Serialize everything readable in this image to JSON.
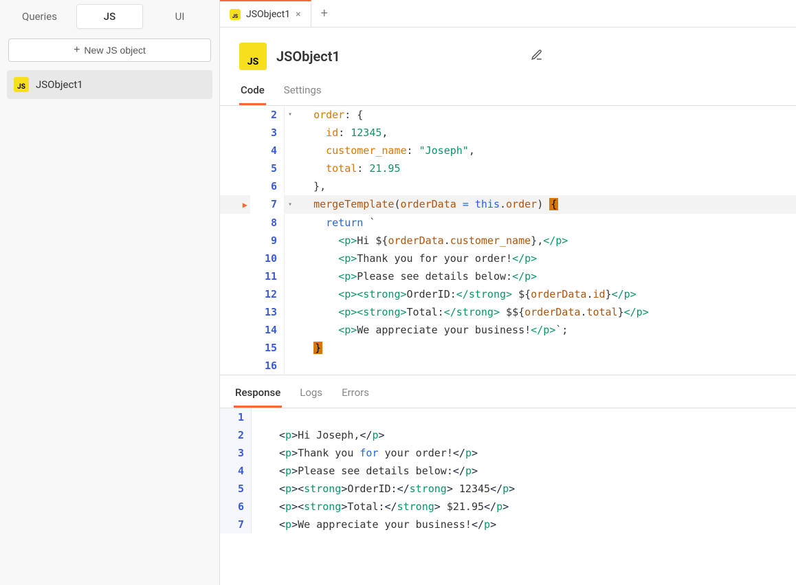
{
  "sidebar": {
    "tabs": [
      "Queries",
      "JS",
      "UI"
    ],
    "active_tab": 1,
    "new_button_label": "New JS object",
    "items": [
      {
        "icon": "js-badge-icon",
        "label": "JSObject1",
        "active": true
      }
    ]
  },
  "tabs_bar": {
    "tabs": [
      {
        "icon": "js-badge-icon",
        "label": "JSObject1",
        "closeable": true
      }
    ]
  },
  "header": {
    "icon": "js-badge-icon",
    "title": "JSObject1"
  },
  "sub_tabs": {
    "items": [
      "Code",
      "Settings"
    ],
    "active": 0
  },
  "code_editor": {
    "lines": [
      {
        "n": 2,
        "fold": "▾",
        "tokens": [
          {
            "t": "  ",
            "c": ""
          },
          {
            "t": "order",
            "c": "tok-orange"
          },
          {
            "t": ": {",
            "c": ""
          }
        ]
      },
      {
        "n": 3,
        "tokens": [
          {
            "t": "    ",
            "c": ""
          },
          {
            "t": "id",
            "c": "tok-orange"
          },
          {
            "t": ": ",
            "c": ""
          },
          {
            "t": "12345",
            "c": "tok-num"
          },
          {
            "t": ",",
            "c": ""
          }
        ]
      },
      {
        "n": 4,
        "tokens": [
          {
            "t": "    ",
            "c": ""
          },
          {
            "t": "customer_name",
            "c": "tok-orange"
          },
          {
            "t": ": ",
            "c": ""
          },
          {
            "t": "\"Joseph\"",
            "c": "tok-str"
          },
          {
            "t": ",",
            "c": ""
          }
        ]
      },
      {
        "n": 5,
        "tokens": [
          {
            "t": "    ",
            "c": ""
          },
          {
            "t": "total",
            "c": "tok-orange"
          },
          {
            "t": ": ",
            "c": ""
          },
          {
            "t": "21.95",
            "c": "tok-num"
          }
        ]
      },
      {
        "n": 6,
        "tokens": [
          {
            "t": "  },",
            "c": ""
          }
        ]
      },
      {
        "n": 7,
        "fold": "▾",
        "bp": true,
        "hl": true,
        "tokens": [
          {
            "t": "  ",
            "c": ""
          },
          {
            "t": "mergeTemplate",
            "c": "tok-fn"
          },
          {
            "t": "(",
            "c": ""
          },
          {
            "t": "orderData",
            "c": "tok-var"
          },
          {
            "t": " ",
            "c": ""
          },
          {
            "t": "=",
            "c": "tok-op"
          },
          {
            "t": " ",
            "c": ""
          },
          {
            "t": "this",
            "c": "tok-this"
          },
          {
            "t": ".",
            "c": ""
          },
          {
            "t": "order",
            "c": "tok-var"
          },
          {
            "t": ") ",
            "c": ""
          },
          {
            "t": "{",
            "c": "tok-brace-err"
          }
        ]
      },
      {
        "n": 8,
        "tokens": [
          {
            "t": "    ",
            "c": ""
          },
          {
            "t": "return",
            "c": "tok-purple"
          },
          {
            "t": " `",
            "c": ""
          }
        ]
      },
      {
        "n": 9,
        "tokens": [
          {
            "t": "      ",
            "c": ""
          },
          {
            "t": "<p>",
            "c": "tok-tag"
          },
          {
            "t": "Hi ",
            "c": "tok-txt"
          },
          {
            "t": "${",
            "c": ""
          },
          {
            "t": "orderData",
            "c": "tok-var"
          },
          {
            "t": ".",
            "c": ""
          },
          {
            "t": "customer_name",
            "c": "tok-var"
          },
          {
            "t": "}",
            "c": ""
          },
          {
            "t": ",",
            "c": "tok-txt"
          },
          {
            "t": "</p>",
            "c": "tok-tag"
          }
        ]
      },
      {
        "n": 10,
        "tokens": [
          {
            "t": "      ",
            "c": ""
          },
          {
            "t": "<p>",
            "c": "tok-tag"
          },
          {
            "t": "Thank you for your order!",
            "c": "tok-txt"
          },
          {
            "t": "</p>",
            "c": "tok-tag"
          }
        ]
      },
      {
        "n": 11,
        "tokens": [
          {
            "t": "      ",
            "c": ""
          },
          {
            "t": "<p>",
            "c": "tok-tag"
          },
          {
            "t": "Please see details below:",
            "c": "tok-txt"
          },
          {
            "t": "</p>",
            "c": "tok-tag"
          }
        ]
      },
      {
        "n": 12,
        "tokens": [
          {
            "t": "      ",
            "c": ""
          },
          {
            "t": "<p><strong>",
            "c": "tok-tag"
          },
          {
            "t": "OrderID:",
            "c": "tok-txt"
          },
          {
            "t": "</strong>",
            "c": "tok-tag"
          },
          {
            "t": " ",
            "c": "tok-txt"
          },
          {
            "t": "${",
            "c": ""
          },
          {
            "t": "orderData",
            "c": "tok-var"
          },
          {
            "t": ".",
            "c": ""
          },
          {
            "t": "id",
            "c": "tok-var"
          },
          {
            "t": "}",
            "c": ""
          },
          {
            "t": "</p>",
            "c": "tok-tag"
          }
        ]
      },
      {
        "n": 13,
        "tokens": [
          {
            "t": "      ",
            "c": ""
          },
          {
            "t": "<p><strong>",
            "c": "tok-tag"
          },
          {
            "t": "Total:",
            "c": "tok-txt"
          },
          {
            "t": "</strong>",
            "c": "tok-tag"
          },
          {
            "t": " $",
            "c": "tok-txt"
          },
          {
            "t": "${",
            "c": ""
          },
          {
            "t": "orderData",
            "c": "tok-var"
          },
          {
            "t": ".",
            "c": ""
          },
          {
            "t": "total",
            "c": "tok-var"
          },
          {
            "t": "}",
            "c": ""
          },
          {
            "t": "</p>",
            "c": "tok-tag"
          }
        ]
      },
      {
        "n": 14,
        "tokens": [
          {
            "t": "      ",
            "c": ""
          },
          {
            "t": "<p>",
            "c": "tok-tag"
          },
          {
            "t": "We appreciate your business!",
            "c": "tok-txt"
          },
          {
            "t": "</p>",
            "c": "tok-tag"
          },
          {
            "t": "`;",
            "c": ""
          }
        ]
      },
      {
        "n": 15,
        "tokens": [
          {
            "t": "  ",
            "c": ""
          },
          {
            "t": "}",
            "c": "tok-brace-err"
          }
        ]
      },
      {
        "n": 16,
        "tokens": [
          {
            "t": "",
            "c": ""
          }
        ]
      }
    ]
  },
  "response_pane": {
    "tabs": [
      "Response",
      "Logs",
      "Errors"
    ],
    "active": 0,
    "lines": [
      {
        "n": 1,
        "tokens": []
      },
      {
        "n": 2,
        "tokens": [
          {
            "t": "<",
            "c": "tok-dark"
          },
          {
            "t": "p",
            "c": "tok-green"
          },
          {
            "t": ">",
            "c": "tok-dark"
          },
          {
            "t": "Hi Joseph,",
            "c": "tok-txt"
          },
          {
            "t": "</",
            "c": "tok-dark"
          },
          {
            "t": "p",
            "c": "tok-green"
          },
          {
            "t": ">",
            "c": "tok-dark"
          }
        ]
      },
      {
        "n": 3,
        "tokens": [
          {
            "t": "<",
            "c": "tok-dark"
          },
          {
            "t": "p",
            "c": "tok-green"
          },
          {
            "t": ">",
            "c": "tok-dark"
          },
          {
            "t": "Thank you ",
            "c": "tok-txt"
          },
          {
            "t": "for",
            "c": "tok-purple"
          },
          {
            "t": " your order!",
            "c": "tok-txt"
          },
          {
            "t": "</",
            "c": "tok-dark"
          },
          {
            "t": "p",
            "c": "tok-green"
          },
          {
            "t": ">",
            "c": "tok-dark"
          }
        ]
      },
      {
        "n": 4,
        "tokens": [
          {
            "t": "<",
            "c": "tok-dark"
          },
          {
            "t": "p",
            "c": "tok-green"
          },
          {
            "t": ">",
            "c": "tok-dark"
          },
          {
            "t": "Please see details below:",
            "c": "tok-txt"
          },
          {
            "t": "</",
            "c": "tok-dark"
          },
          {
            "t": "p",
            "c": "tok-green"
          },
          {
            "t": ">",
            "c": "tok-dark"
          }
        ]
      },
      {
        "n": 5,
        "tokens": [
          {
            "t": "<",
            "c": "tok-dark"
          },
          {
            "t": "p",
            "c": "tok-green"
          },
          {
            "t": "><",
            "c": "tok-dark"
          },
          {
            "t": "strong",
            "c": "tok-green"
          },
          {
            "t": ">",
            "c": "tok-dark"
          },
          {
            "t": "OrderID:",
            "c": "tok-txt"
          },
          {
            "t": "</",
            "c": "tok-dark"
          },
          {
            "t": "strong",
            "c": "tok-green"
          },
          {
            "t": ">",
            "c": "tok-dark"
          },
          {
            "t": " 12345",
            "c": "tok-txt"
          },
          {
            "t": "</",
            "c": "tok-dark"
          },
          {
            "t": "p",
            "c": "tok-green"
          },
          {
            "t": ">",
            "c": "tok-dark"
          }
        ]
      },
      {
        "n": 6,
        "tokens": [
          {
            "t": "<",
            "c": "tok-dark"
          },
          {
            "t": "p",
            "c": "tok-green"
          },
          {
            "t": "><",
            "c": "tok-dark"
          },
          {
            "t": "strong",
            "c": "tok-green"
          },
          {
            "t": ">",
            "c": "tok-dark"
          },
          {
            "t": "Total:",
            "c": "tok-txt"
          },
          {
            "t": "</",
            "c": "tok-dark"
          },
          {
            "t": "strong",
            "c": "tok-green"
          },
          {
            "t": ">",
            "c": "tok-dark"
          },
          {
            "t": " $21.95",
            "c": "tok-txt"
          },
          {
            "t": "</",
            "c": "tok-dark"
          },
          {
            "t": "p",
            "c": "tok-green"
          },
          {
            "t": ">",
            "c": "tok-dark"
          }
        ]
      },
      {
        "n": 7,
        "tokens": [
          {
            "t": "<",
            "c": "tok-dark"
          },
          {
            "t": "p",
            "c": "tok-green"
          },
          {
            "t": ">",
            "c": "tok-dark"
          },
          {
            "t": "We appreciate your business!",
            "c": "tok-txt"
          },
          {
            "t": "</",
            "c": "tok-dark"
          },
          {
            "t": "p",
            "c": "tok-green"
          },
          {
            "t": ">",
            "c": "tok-dark"
          }
        ]
      }
    ]
  }
}
